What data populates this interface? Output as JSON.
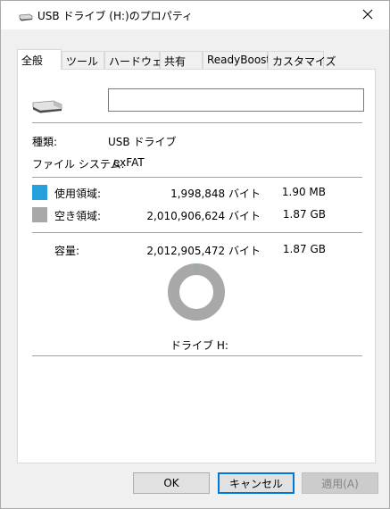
{
  "window": {
    "title": "USB ドライブ (H:)のプロパティ",
    "close_glyph": "✕"
  },
  "tabs": [
    {
      "label": "全般",
      "active": true
    },
    {
      "label": "ツール",
      "active": false
    },
    {
      "label": "ハードウェア",
      "active": false
    },
    {
      "label": "共有",
      "active": false
    },
    {
      "label": "ReadyBoost",
      "active": false
    },
    {
      "label": "カスタマイズ",
      "active": false
    }
  ],
  "general": {
    "volume_name_value": "",
    "type_label": "種類:",
    "type_value": "USB ドライブ",
    "fs_label": "ファイル システム:",
    "fs_value": "exFAT"
  },
  "usage": {
    "used": {
      "label": "使用領域:",
      "bytes": "1,998,848 バイト",
      "size": "1.90 MB",
      "color": "#26a0da"
    },
    "free": {
      "label": "空き領域:",
      "bytes": "2,010,906,624 バイト",
      "size": "1.87 GB",
      "color": "#a8a8a8"
    },
    "capacity": {
      "label": "容量:",
      "bytes": "2,012,905,472 バイト",
      "size": "1.87 GB"
    },
    "used_fraction": 0.001
  },
  "drive_caption": "ドライブ H:",
  "buttons": {
    "ok": "OK",
    "cancel": "キャンセル",
    "apply": "適用(A)"
  },
  "icons": {
    "title_icon": "usb-drive-icon",
    "drive_icon": "usb-drive-icon"
  }
}
